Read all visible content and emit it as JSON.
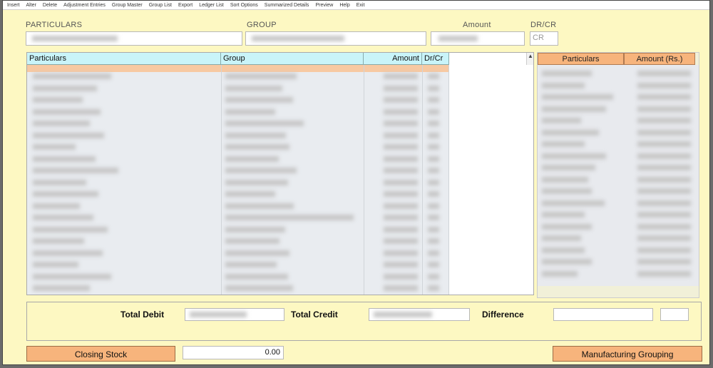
{
  "menu": {
    "items": [
      "Insert",
      "Alter",
      "Delete",
      "Adjustment Entries",
      "Group Master",
      "Group List",
      "Export",
      "Ledger List",
      "Sort Options",
      "Summarized Details",
      "Preview",
      "Help",
      "Exit"
    ]
  },
  "form": {
    "particulars_label": "PARTICULARS",
    "group_label": "GROUP",
    "amount_label": "Amount",
    "drcr_label": "DR/CR",
    "drcr_value": "CR"
  },
  "grid": {
    "headers": [
      "Particulars",
      "Group",
      "Amount",
      "Dr/Cr"
    ]
  },
  "summary": {
    "headers": [
      "Particulars",
      "Amount (Rs.)"
    ]
  },
  "totals": {
    "total_debit_label": "Total Debit",
    "total_credit_label": "Total Credit",
    "difference_label": "Difference"
  },
  "closing_stock": {
    "button_label": "Closing Stock",
    "value": "0.00"
  },
  "manufacturing_button_label": "Manufacturing Grouping"
}
